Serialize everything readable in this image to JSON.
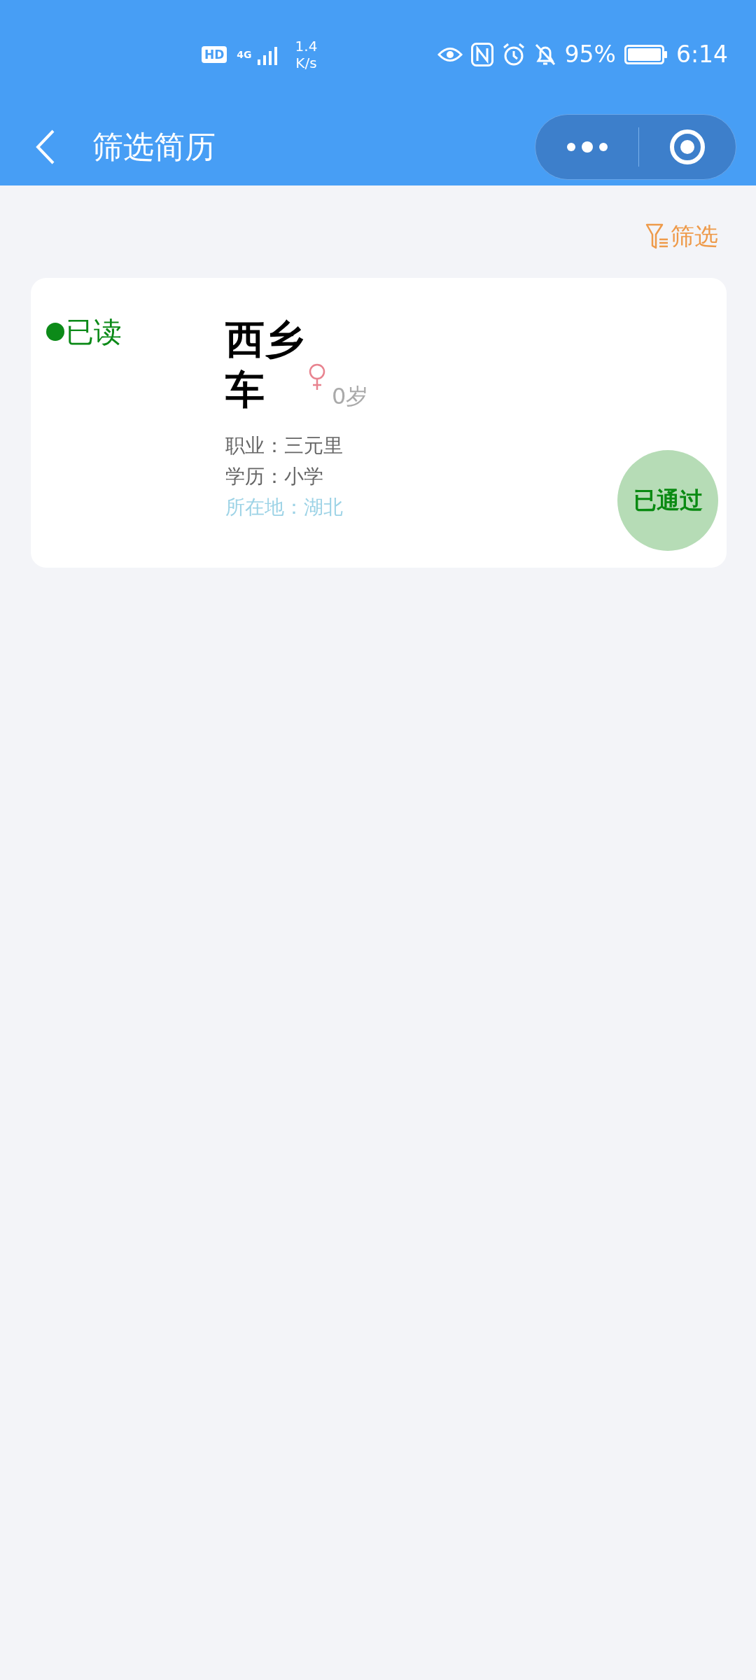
{
  "status_bar": {
    "hd": "HD",
    "network": "4G",
    "speed_value": "1.4",
    "speed_unit": "K/s",
    "battery": "95%",
    "time": "6:14"
  },
  "header": {
    "title": "筛选简历"
  },
  "filter": {
    "label": "筛选"
  },
  "resumes": [
    {
      "read": true,
      "read_label": "已读",
      "name": "西乡车",
      "female": true,
      "age": "0岁",
      "job": "职业：三元里",
      "education": "学历：小学",
      "location": "所在地：湖北",
      "status": "已通过"
    }
  ]
}
